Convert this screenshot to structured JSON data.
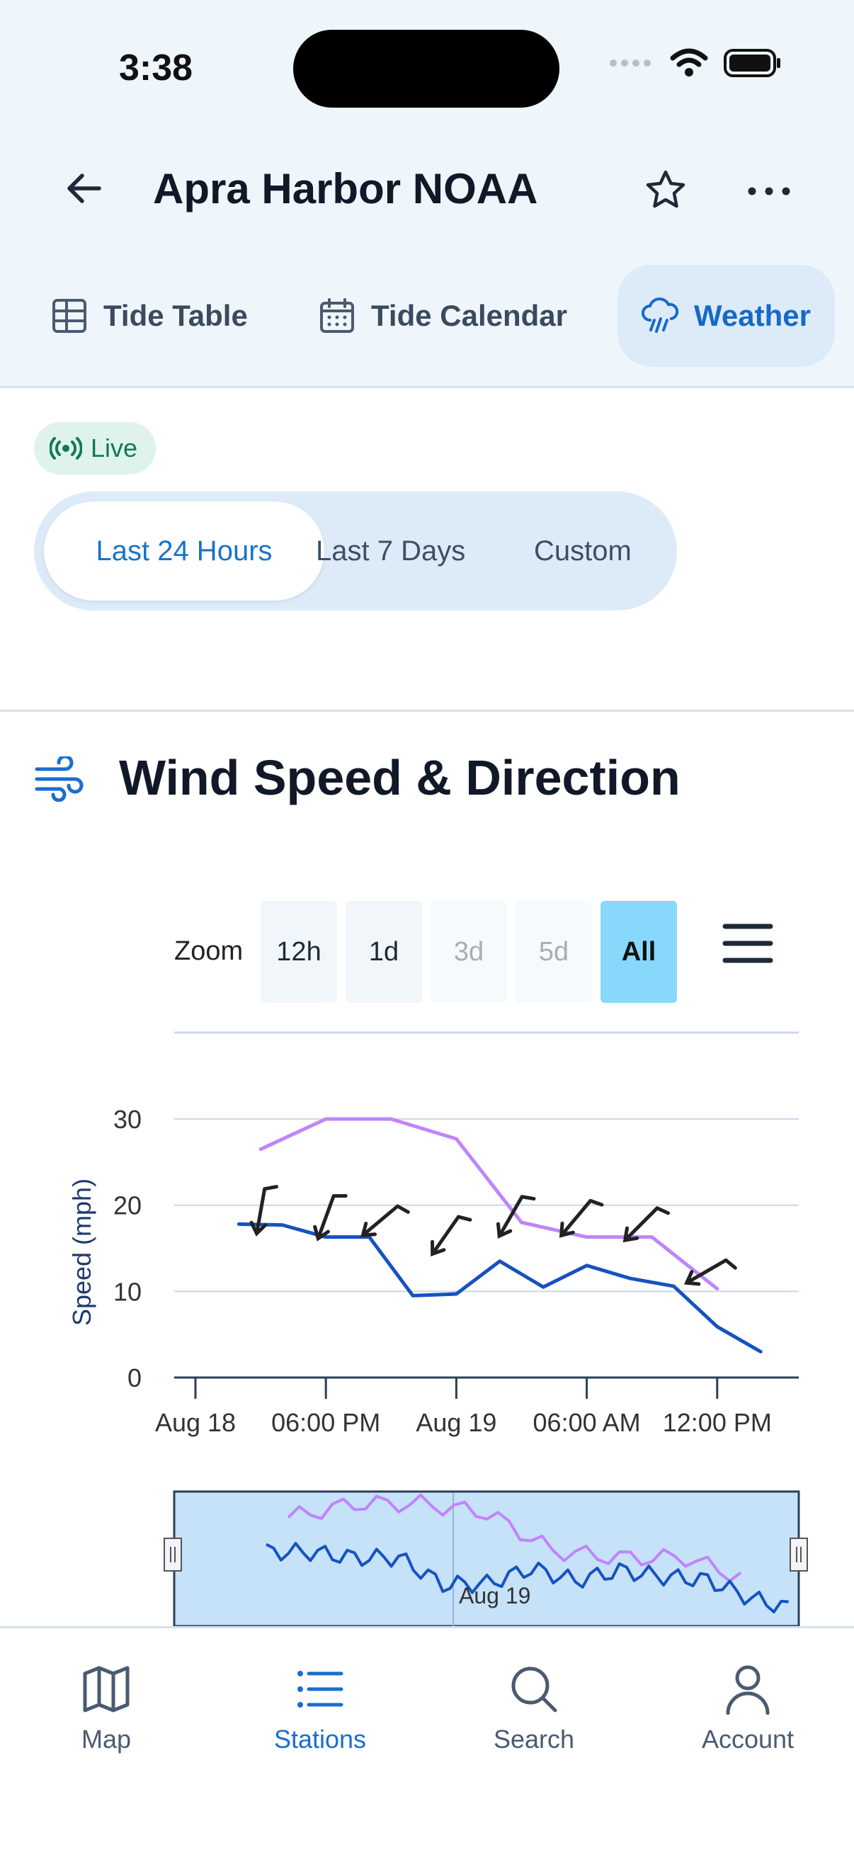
{
  "status_bar": {
    "time": "3:38"
  },
  "header": {
    "title": "Apra Harbor NOAA"
  },
  "tabs": [
    {
      "label": "Tide Table",
      "icon": "table-icon"
    },
    {
      "label": "Tide Calendar",
      "icon": "calendar-icon"
    },
    {
      "label": "Weather",
      "icon": "cloud-rain-icon",
      "active": true
    }
  ],
  "live_badge": "Live",
  "range_selector": {
    "options": [
      "Last 24 Hours",
      "Last 7 Days",
      "Custom"
    ],
    "selected": "Last 24 Hours"
  },
  "section": {
    "title": "Wind Speed & Direction",
    "icon": "wind-icon"
  },
  "zoom": {
    "label": "Zoom",
    "buttons": [
      {
        "label": "12h",
        "state": "enabled"
      },
      {
        "label": "1d",
        "state": "enabled"
      },
      {
        "label": "3d",
        "state": "disabled"
      },
      {
        "label": "5d",
        "state": "disabled"
      },
      {
        "label": "All",
        "state": "active"
      }
    ]
  },
  "chart_data": {
    "type": "line",
    "ylabel": "Speed (mph)",
    "ylim": [
      0,
      30
    ],
    "y_ticks": [
      0,
      10,
      20,
      30
    ],
    "x_tick_labels": [
      "Aug 18",
      "06:00 PM",
      "Aug 19",
      "06:00 AM",
      "12:00 PM"
    ],
    "x_tick_hours": [
      0,
      6,
      12,
      18,
      24
    ],
    "grid": true,
    "series": [
      {
        "color": "#c084fc",
        "x_hours": [
          3,
          6,
          9,
          12,
          15,
          18,
          21,
          24
        ],
        "values": [
          26.5,
          30,
          30,
          27.7,
          18,
          16.3,
          16.3,
          10.3
        ]
      },
      {
        "color": "#1652c0",
        "x_hours": [
          2,
          4,
          6,
          8,
          10,
          12,
          14,
          16,
          18,
          20,
          22,
          24,
          26
        ],
        "values": [
          17.8,
          17.7,
          16.3,
          16.3,
          9.5,
          9.7,
          13.5,
          10.5,
          13,
          11.5,
          10.6,
          5.9,
          3
        ]
      }
    ],
    "direction_arrows": [
      {
        "x_hour": 3,
        "value": 19.3,
        "angle_deg": 100
      },
      {
        "x_hour": 6,
        "value": 18.6,
        "angle_deg": 110
      },
      {
        "x_hour": 8.5,
        "value": 18.2,
        "angle_deg": 140
      },
      {
        "x_hour": 11.5,
        "value": 16.5,
        "angle_deg": 125
      },
      {
        "x_hour": 14.5,
        "value": 18.7,
        "angle_deg": 120
      },
      {
        "x_hour": 17.5,
        "value": 18.5,
        "angle_deg": 130
      },
      {
        "x_hour": 20.5,
        "value": 17.8,
        "angle_deg": 135
      },
      {
        "x_hour": 23.5,
        "value": 12.3,
        "angle_deg": 150
      }
    ],
    "navigator_label": "Aug 19"
  },
  "bottom_nav": [
    {
      "label": "Map",
      "icon": "map-icon"
    },
    {
      "label": "Stations",
      "icon": "list-icon",
      "active": true
    },
    {
      "label": "Search",
      "icon": "search-icon"
    },
    {
      "label": "Account",
      "icon": "user-icon"
    }
  ]
}
